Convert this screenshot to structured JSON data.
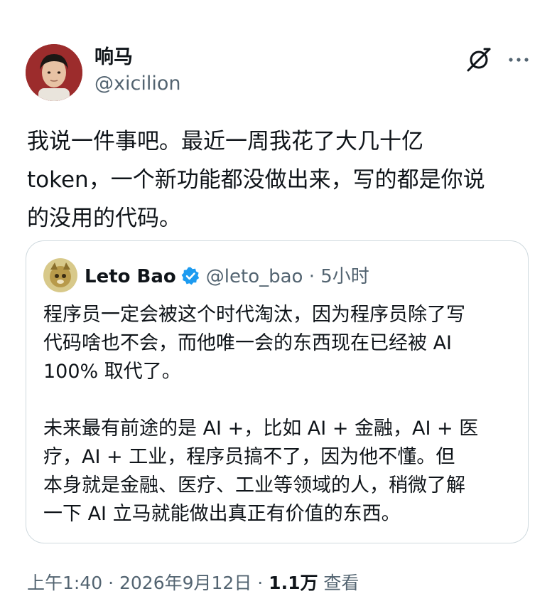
{
  "tweet": {
    "author": {
      "display_name": "响马",
      "handle": "@xicilion"
    },
    "text": "我说一件事吧。最近一周我花了大几十亿\ntoken，一个新功能都没做出来，写的都是你说\n的没用的代码。",
    "icons": {
      "grok": "grok-icon",
      "more": "more-options-icon"
    }
  },
  "quote": {
    "author": {
      "display_name": "Leto Bao",
      "handle": "@leto_bao",
      "separator": "·",
      "time": "5小时",
      "verified": true
    },
    "text": "程序员一定会被这个时代淘汰，因为程序员除了写\n代码啥也不会，而他唯一会的东西现在已经被 AI\n100% 取代了。\n\n未来最有前途的是 AI +，比如 AI + 金融，AI + 医\n疗，AI + 工业，程序员搞不了，因为他不懂。但\n本身就是金融、医疗、工业等领域的人，稍微了解\n一下 AI 立马就能做出真正有价值的东西。"
  },
  "meta": {
    "time": "上午1:40",
    "separator_1": " · ",
    "date": "2026年9月12日",
    "separator_2": " · ",
    "views_count": "1.1万",
    "views_label": " 查看"
  },
  "colors": {
    "text_primary": "#0f1419",
    "text_secondary": "#536471",
    "border": "#cfd9de",
    "verified_blue": "#1d9bf0",
    "avatar_bg": "#9c2c2c"
  }
}
